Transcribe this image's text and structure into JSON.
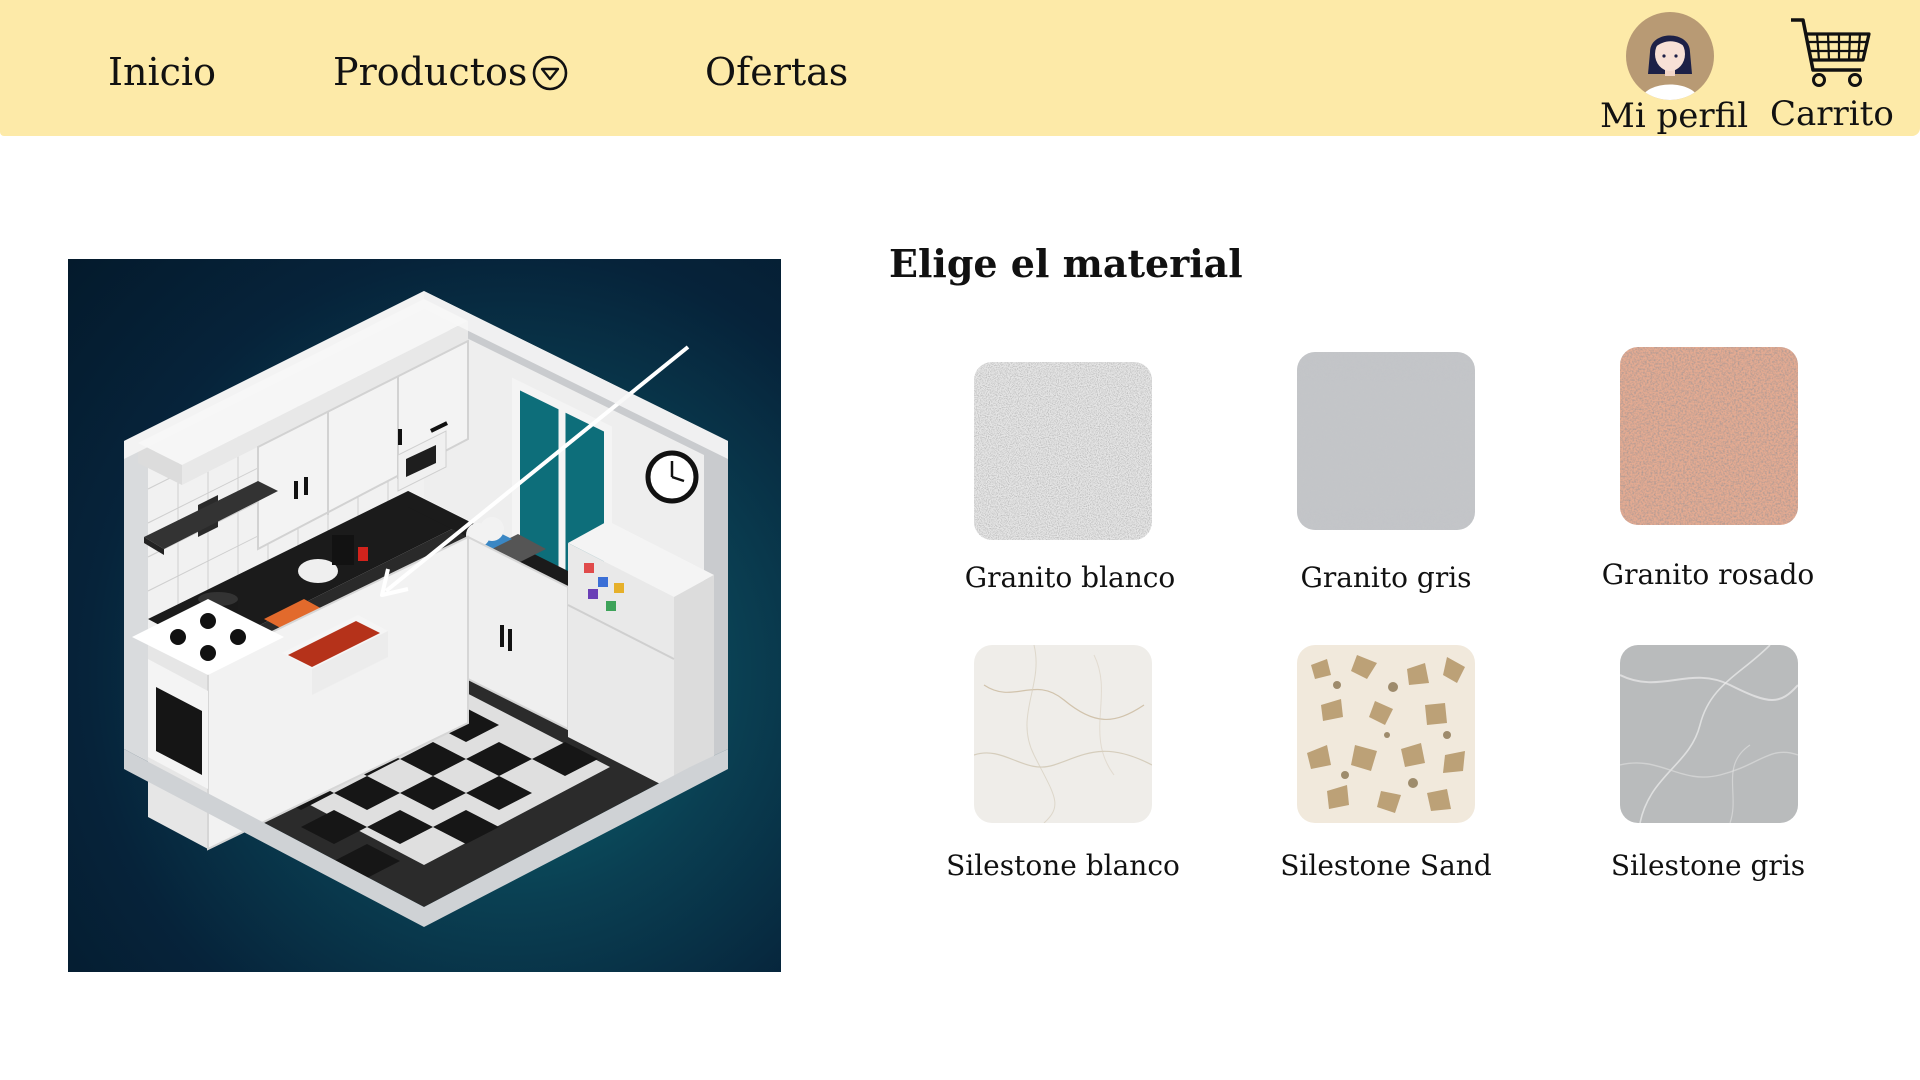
{
  "nav": {
    "inicio": "Inicio",
    "productos": "Productos",
    "ofertas": "Ofertas"
  },
  "header_actions": {
    "profile_label": "Mi perfil",
    "cart_label": "Carrito"
  },
  "icons": {
    "productos_dropdown": "chevron-down-circle-icon",
    "profile": "avatar-icon",
    "cart": "shopping-cart-icon"
  },
  "colors": {
    "header_bg": "#fdeaa8",
    "page_bg": "#ffffff",
    "text": "#111111"
  },
  "materials": {
    "title": "Elige el material",
    "items": [
      {
        "label": "Granito blanco",
        "color": "#d9d9d9"
      },
      {
        "label": "Granito gris",
        "color": "#b9bcc0"
      },
      {
        "label": "Granito rosado",
        "color": "#e2a88e"
      },
      {
        "label": "Silestone blanco",
        "color": "#eeebe6"
      },
      {
        "label": "Silestone Sand",
        "color": "#eee3d2"
      },
      {
        "label": "Silestone gris",
        "color": "#b7b9ba"
      }
    ]
  }
}
